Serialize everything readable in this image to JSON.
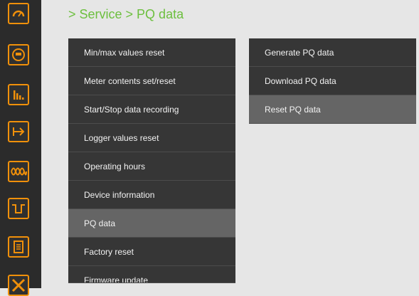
{
  "breadcrumb": "> Service > PQ data",
  "sidebar": {
    "icons": [
      {
        "name": "gauge-icon",
        "color": "#f0900a"
      },
      {
        "name": "meter-icon",
        "color": "#f0900a"
      },
      {
        "name": "bar-chart-icon",
        "color": "#f0900a"
      },
      {
        "name": "phasor-icon",
        "color": "#f0900a"
      },
      {
        "name": "waveform-icon",
        "color": "#f0900a"
      },
      {
        "name": "pulse-icon",
        "color": "#f0900a"
      },
      {
        "name": "list-icon",
        "color": "#f0900a"
      },
      {
        "name": "tools-icon",
        "color": "#f0900a"
      }
    ]
  },
  "menu": {
    "items": [
      {
        "label": "Min/max values reset"
      },
      {
        "label": "Meter contents set/reset"
      },
      {
        "label": "Start/Stop data recording"
      },
      {
        "label": "Logger values reset"
      },
      {
        "label": "Operating hours"
      },
      {
        "label": "Device information"
      },
      {
        "label": "PQ data",
        "active": true
      },
      {
        "label": "Factory reset"
      },
      {
        "label": "Firmware update"
      }
    ]
  },
  "submenu": {
    "items": [
      {
        "label": "Generate PQ data"
      },
      {
        "label": "Download PQ data"
      },
      {
        "label": "Reset PQ data",
        "active": true
      }
    ]
  },
  "colors": {
    "accent": "#f0900a",
    "breadcrumb": "#6cbf3e",
    "sidebar_bg": "#2b2b2b",
    "menu_bg": "#363636",
    "menu_active_bg": "#656565"
  }
}
